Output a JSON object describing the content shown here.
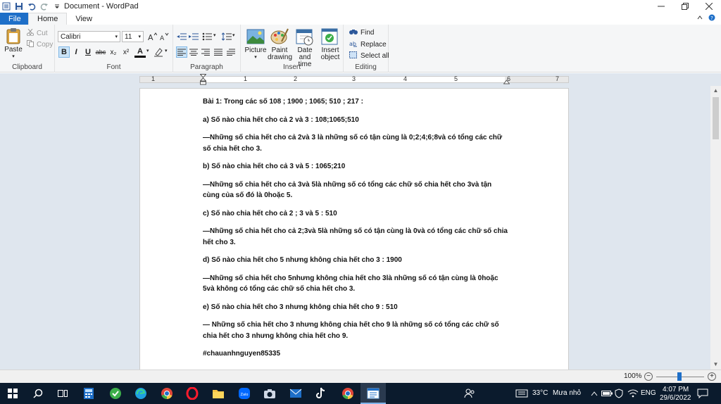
{
  "window": {
    "title": "Document - WordPad"
  },
  "tabs": [
    {
      "label": "File"
    },
    {
      "label": "Home"
    },
    {
      "label": "View"
    }
  ],
  "ribbon": {
    "clipboard": {
      "label": "Clipboard",
      "paste": "Paste",
      "cut": "Cut",
      "copy": "Copy"
    },
    "font": {
      "label": "Font",
      "family": "Calibri",
      "size": "11",
      "bold": "B",
      "italic": "I",
      "underline": "U",
      "strike": "abc",
      "subscript": "x₂",
      "superscript": "x²",
      "color_letter": "A"
    },
    "paragraph": {
      "label": "Paragraph"
    },
    "insert": {
      "label": "Insert",
      "picture": "Picture",
      "paint": "Paint drawing",
      "datetime": "Date and time",
      "object": "Insert object"
    },
    "editing": {
      "label": "Editing",
      "find": "Find",
      "replace": "Replace",
      "select_all": "Select all"
    }
  },
  "ruler": {
    "numbers": [
      "1",
      "1",
      "2",
      "3",
      "4",
      "5",
      "6",
      "7"
    ]
  },
  "document": {
    "paragraphs": [
      "Bài 1: Trong các số 108 ; 1900 ; 1065; 510 ; 217 :",
      "a) Số nào chia hết cho cả 2 và 3 : 108;1065;510",
      "—Những số chia hết cho cả 2và 3 là những số có tận cùng là 0;2;4;6;8và có tổng các chữ số chia hết cho 3.",
      "b) Số nào chia hết cho cả 3 và 5 : 1065;210",
      "—Những số chia hết cho cả 3và 5là những số có tổng các chữ số chia hết cho 3và tận cùng của số đó là 0hoặc 5.",
      "c) Số nào chia hết cho cả 2 ; 3 và 5 : 510",
      "—Những số chia hết cho cả 2;3và 5là những số có tận cùng là 0và có tổng các chữ số chia hết cho 3.",
      "d) Số nào chia hết cho 5 nhưng không chia hết cho 3 : 1900",
      "—Những số chia hết cho 5nhưng không chia hết cho 3là những số có tận cùng là 0hoặc 5và không có tổng các chữ số chia hết cho 3.",
      "e) Số nào chia hết cho 3 nhưng không chia hết cho 9  : 510",
      "— Những số chia hết cho 3 nhưng không chia hết cho 9 là những số có tổng các chữ số chia hết cho 3 nhưng không chia hết cho 9.",
      "#chauanhnguyen85335"
    ]
  },
  "status": {
    "zoom": "100%",
    "zoom_level_percent": 100
  },
  "taskbar": {
    "temperature": "33°C",
    "weather": "Mưa nhỏ",
    "language": "ENG",
    "time": "4:07 PM",
    "date": "29/6/2022"
  },
  "colors": {
    "file_tab": "#1e6fc8",
    "ribbon_bg": "#f5f6f7",
    "workspace_bg": "#dfe6ee",
    "taskbar_bg": "#0b1b2d"
  }
}
